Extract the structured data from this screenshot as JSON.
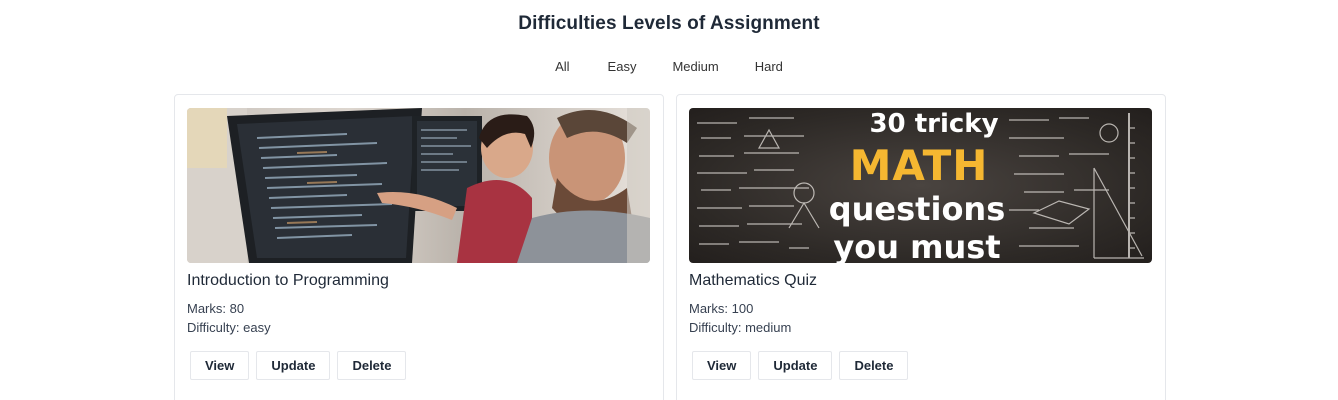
{
  "page": {
    "title": "Difficulties Levels of Assignment"
  },
  "filters": [
    "All",
    "Easy",
    "Medium",
    "Hard"
  ],
  "assignments": [
    {
      "title": "Introduction to Programming",
      "marks": "Marks: 80",
      "difficulty": "Difficulty: easy",
      "actions": {
        "view": "View",
        "update": "Update",
        "delete": "Delete"
      }
    },
    {
      "title": "Mathematics Quiz",
      "marks": "Marks: 100",
      "difficulty": "Difficulty: medium",
      "image_text": [
        "30 tricky",
        "MATH",
        "questions",
        "you must"
      ],
      "actions": {
        "view": "View",
        "update": "Update",
        "delete": "Delete"
      }
    }
  ],
  "colors": {
    "text": "#1f2937",
    "border": "#e5e7eb",
    "math_accent": "#f5b731"
  }
}
